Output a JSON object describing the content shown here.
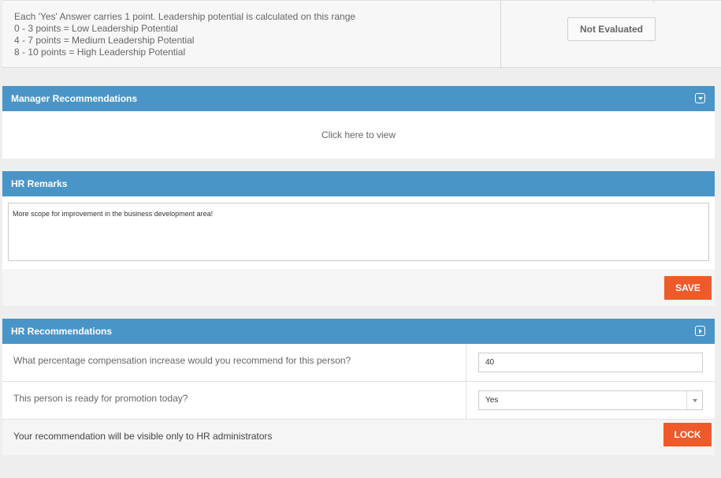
{
  "leadership": {
    "lines": [
      "Each 'Yes' Answer carries 1 point. Leadership potential is calculated on this range",
      "0 - 3 points = Low Leadership Potential",
      "4 - 7 points = Medium Leadership Potential",
      "8 - 10 points = High Leadership Potential"
    ],
    "status_button": "Not Evaluated"
  },
  "manager_recommendations": {
    "title": "Manager Recommendations",
    "toggle_icon": "chevron-down-box-icon",
    "view_link": "Click here to view"
  },
  "hr_remarks": {
    "title": "HR Remarks",
    "text": "More scope for improvement in the business development area!",
    "save_label": "SAVE"
  },
  "hr_recommendations": {
    "title": "HR Recommendations",
    "toggle_icon": "chevron-right-box-icon",
    "questions": [
      {
        "label": "What percentage compensation increase would you recommend for this person?",
        "value": "40"
      },
      {
        "label": "This person is ready for promotion today?",
        "value": "Yes"
      }
    ],
    "note": "Your recommendation will be visible only to HR administrators",
    "lock_label": "LOCK"
  },
  "colors": {
    "header_blue": "#4a95c8",
    "action_orange": "#ef5a2a"
  }
}
